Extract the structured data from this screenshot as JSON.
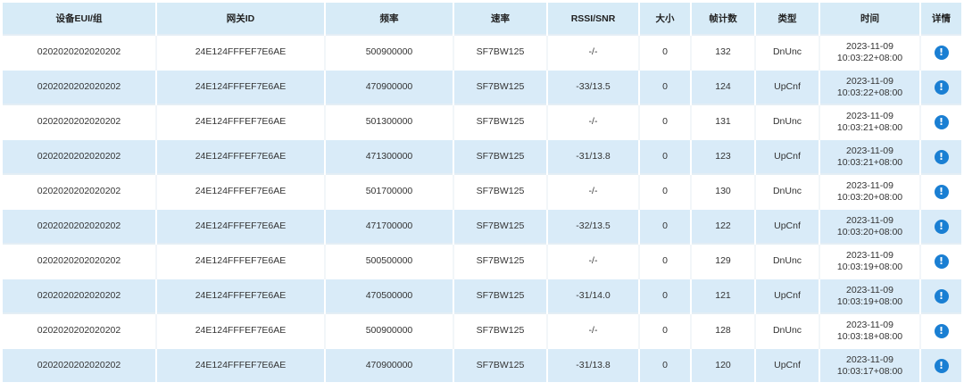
{
  "table": {
    "headers": {
      "dev_eui": "设备EUI/组",
      "gateway_id": "网关ID",
      "frequency": "频率",
      "data_rate": "速率",
      "rssi_snr": "RSSI/SNR",
      "size": "大小",
      "fcnt": "帧计数",
      "type": "类型",
      "time": "时间",
      "details": "详情"
    },
    "rows": [
      {
        "dev_eui": "0202020202020202",
        "gateway_id": "24E124FFFEF7E6AE",
        "frequency": "500900000",
        "data_rate": "SF7BW125",
        "rssi_snr": "-/-",
        "size": "0",
        "fcnt": "132",
        "type": "DnUnc",
        "date": "2023-11-09",
        "clock": "10:03:22+08:00"
      },
      {
        "dev_eui": "0202020202020202",
        "gateway_id": "24E124FFFEF7E6AE",
        "frequency": "470900000",
        "data_rate": "SF7BW125",
        "rssi_snr": "-33/13.5",
        "size": "0",
        "fcnt": "124",
        "type": "UpCnf",
        "date": "2023-11-09",
        "clock": "10:03:22+08:00"
      },
      {
        "dev_eui": "0202020202020202",
        "gateway_id": "24E124FFFEF7E6AE",
        "frequency": "501300000",
        "data_rate": "SF7BW125",
        "rssi_snr": "-/-",
        "size": "0",
        "fcnt": "131",
        "type": "DnUnc",
        "date": "2023-11-09",
        "clock": "10:03:21+08:00"
      },
      {
        "dev_eui": "0202020202020202",
        "gateway_id": "24E124FFFEF7E6AE",
        "frequency": "471300000",
        "data_rate": "SF7BW125",
        "rssi_snr": "-31/13.8",
        "size": "0",
        "fcnt": "123",
        "type": "UpCnf",
        "date": "2023-11-09",
        "clock": "10:03:21+08:00"
      },
      {
        "dev_eui": "0202020202020202",
        "gateway_id": "24E124FFFEF7E6AE",
        "frequency": "501700000",
        "data_rate": "SF7BW125",
        "rssi_snr": "-/-",
        "size": "0",
        "fcnt": "130",
        "type": "DnUnc",
        "date": "2023-11-09",
        "clock": "10:03:20+08:00"
      },
      {
        "dev_eui": "0202020202020202",
        "gateway_id": "24E124FFFEF7E6AE",
        "frequency": "471700000",
        "data_rate": "SF7BW125",
        "rssi_snr": "-32/13.5",
        "size": "0",
        "fcnt": "122",
        "type": "UpCnf",
        "date": "2023-11-09",
        "clock": "10:03:20+08:00"
      },
      {
        "dev_eui": "0202020202020202",
        "gateway_id": "24E124FFFEF7E6AE",
        "frequency": "500500000",
        "data_rate": "SF7BW125",
        "rssi_snr": "-/-",
        "size": "0",
        "fcnt": "129",
        "type": "DnUnc",
        "date": "2023-11-09",
        "clock": "10:03:19+08:00"
      },
      {
        "dev_eui": "0202020202020202",
        "gateway_id": "24E124FFFEF7E6AE",
        "frequency": "470500000",
        "data_rate": "SF7BW125",
        "rssi_snr": "-31/14.0",
        "size": "0",
        "fcnt": "121",
        "type": "UpCnf",
        "date": "2023-11-09",
        "clock": "10:03:19+08:00"
      },
      {
        "dev_eui": "0202020202020202",
        "gateway_id": "24E124FFFEF7E6AE",
        "frequency": "500900000",
        "data_rate": "SF7BW125",
        "rssi_snr": "-/-",
        "size": "0",
        "fcnt": "128",
        "type": "DnUnc",
        "date": "2023-11-09",
        "clock": "10:03:18+08:00"
      },
      {
        "dev_eui": "0202020202020202",
        "gateway_id": "24E124FFFEF7E6AE",
        "frequency": "470900000",
        "data_rate": "SF7BW125",
        "rssi_snr": "-31/13.8",
        "size": "0",
        "fcnt": "120",
        "type": "UpCnf",
        "date": "2023-11-09",
        "clock": "10:03:17+08:00"
      }
    ],
    "detail_icon": "info-circle-icon",
    "colors": {
      "header_bg": "#d7ebf7",
      "stripe_bg": "#d9ebf8",
      "info_icon": "#1a7fd3"
    }
  }
}
